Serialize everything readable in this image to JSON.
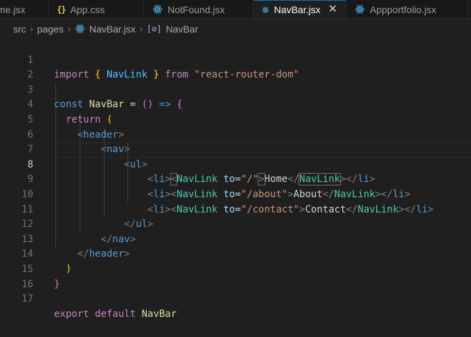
{
  "tabs": [
    {
      "label": "me.jsx",
      "icon": "none",
      "active": false
    },
    {
      "label": "App.css",
      "icon": "braces-icon",
      "active": false
    },
    {
      "label": "NotFound.jsx",
      "icon": "react-icon",
      "active": false
    },
    {
      "label": "NavBar.jsx",
      "icon": "react-icon",
      "active": true
    },
    {
      "label": "Appportfolio.jsx",
      "icon": "react-icon",
      "active": false
    }
  ],
  "breadcrumb": [
    "src",
    "pages",
    "NavBar.jsx",
    "NavBar"
  ],
  "editor": {
    "current_line": 8,
    "line_numbers": [
      "1",
      "2",
      "3",
      "4",
      "5",
      "6",
      "7",
      "8",
      "9",
      "10",
      "11",
      "12",
      "13",
      "14",
      "15",
      "16",
      "17"
    ],
    "lines": {
      "l1": {
        "kw": "import",
        "open": "{",
        "name": "NavLink",
        "close": "}",
        "from": "from",
        "module": "\"react-router-dom\""
      },
      "l3": {
        "kw": "const",
        "name": "NavBar",
        "eq": "=",
        "parens": "()",
        "arrow": "=>",
        "brace": "{"
      },
      "l4": {
        "kw": "return",
        "paren": "("
      },
      "l5": {
        "tag": "header"
      },
      "l6": {
        "tag": "nav"
      },
      "l7": {
        "tag": "ul"
      },
      "links": [
        {
          "li": "li",
          "comp": "NavLink",
          "attr": "to",
          "value": "\"/\"",
          "text": "Home"
        },
        {
          "li": "li",
          "comp": "NavLink",
          "attr": "to",
          "value": "\"/about\"",
          "text": "About"
        },
        {
          "li": "li",
          "comp": "NavLink",
          "attr": "to",
          "value": "\"/contact\"",
          "text": "Contact"
        }
      ],
      "l11": {
        "tag": "ul"
      },
      "l12": {
        "tag": "nav"
      },
      "l13": {
        "tag": "header"
      },
      "l14": {
        "paren": ")"
      },
      "l15": {
        "brace": "}"
      },
      "l17": {
        "kw1": "export",
        "kw2": "default",
        "name": "NavBar"
      }
    }
  }
}
